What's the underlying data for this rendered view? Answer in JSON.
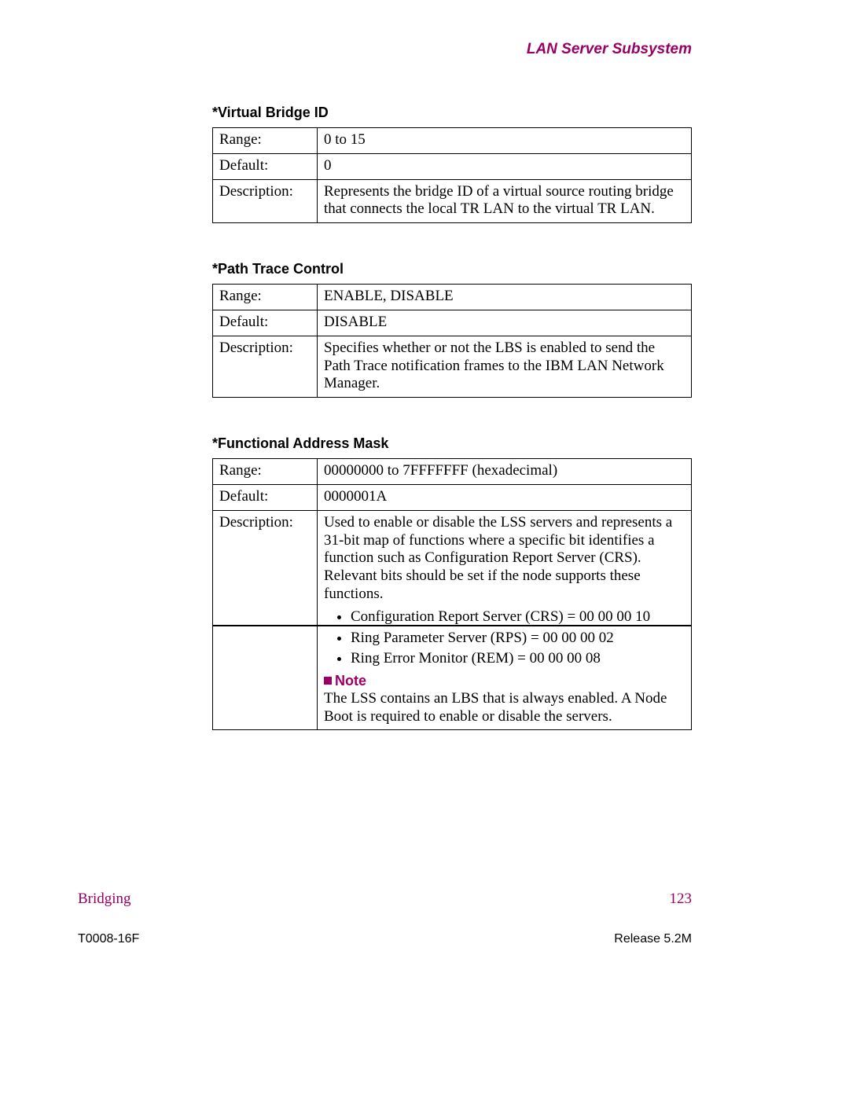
{
  "header": {
    "title": "LAN Server Subsystem"
  },
  "sections": [
    {
      "heading": "*Virtual Bridge ID",
      "rows": {
        "range_label": "Range:",
        "range_value": "0 to 15",
        "default_label": "Default:",
        "default_value": "0",
        "desc_label": "Description:",
        "desc_value": "Represents the bridge ID of a virtual source routing bridge that connects the local TR LAN to the virtual TR LAN."
      }
    },
    {
      "heading": "*Path Trace Control",
      "rows": {
        "range_label": "Range:",
        "range_value": "ENABLE, DISABLE",
        "default_label": "Default:",
        "default_value": "DISABLE",
        "desc_label": "Description:",
        "desc_value": "Specifies whether or not the LBS is enabled to send the Path Trace notification frames to the IBM LAN Network Manager."
      }
    },
    {
      "heading": "*Functional Address Mask",
      "rows": {
        "range_label": "Range:",
        "range_value": "00000000 to 7FFFFFFF (hexadecimal)",
        "default_label": "Default:",
        "default_value": "0000001A",
        "desc_label": "Description:",
        "desc_value": "Used to enable or disable the LSS servers and represents a 31-bit map of functions where a specific bit identifies a function such as Configuration Report Server (CRS). Relevant bits should be set if the node supports these functions."
      },
      "bullets": [
        "Configuration Report Server (CRS) = 00 00 00 10",
        "Ring Parameter Server (RPS) = 00 00 00 02",
        "Ring Error Monitor (REM) = 00 00 00 08"
      ],
      "note": {
        "label": "Note",
        "text": "The LSS contains an LBS that is always enabled. A Node Boot is required to enable or disable the servers."
      }
    }
  ],
  "footer": {
    "chapter": "Bridging",
    "page": "123",
    "docnum": "T0008-16F",
    "release": "Release 5.2M"
  }
}
